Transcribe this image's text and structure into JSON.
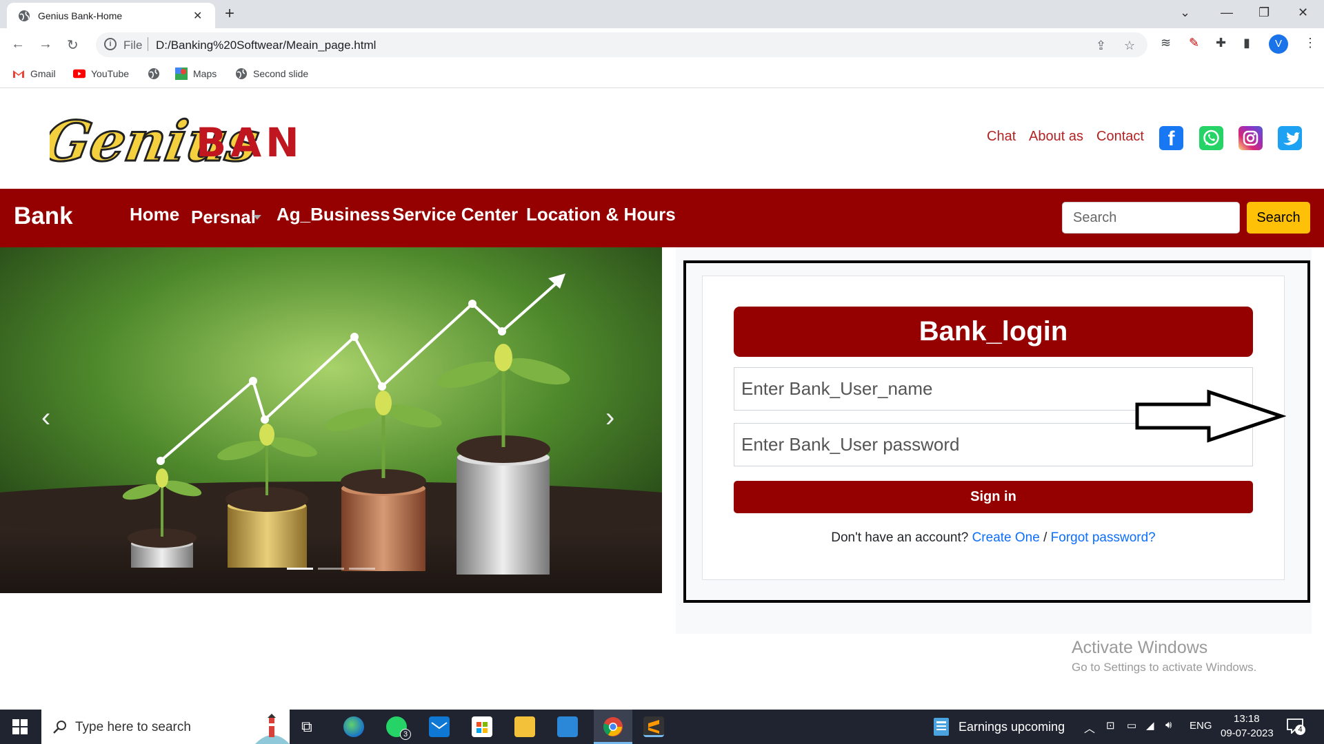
{
  "browser": {
    "tab_title": "Genius Bank-Home",
    "address_file_label": "File",
    "url": "D:/Banking%20Softwear/Meain_page.html",
    "avatar_letter": "V",
    "bookmarks": [
      {
        "label": "Gmail",
        "icon": "gmail-icon"
      },
      {
        "label": "YouTube",
        "icon": "youtube-icon"
      },
      {
        "label": "",
        "icon": "globe-icon"
      },
      {
        "label": "Maps",
        "icon": "maps-icon"
      },
      {
        "label": "Second slide",
        "icon": "globe-icon"
      }
    ]
  },
  "header": {
    "logo_script": "Genius",
    "logo_block": "BANK",
    "links": [
      "Chat",
      "About as",
      "Contact"
    ],
    "social": [
      "facebook",
      "whatsapp",
      "instagram",
      "twitter"
    ]
  },
  "navbar": {
    "brand": "Bank",
    "items": [
      "Home",
      "Persnal",
      "Ag_Business",
      "Service Center",
      "Location & Hours"
    ],
    "search_placeholder": "Search",
    "search_button": "Search"
  },
  "login": {
    "title": "Bank_login",
    "username_placeholder": "Enter Bank_User_name",
    "password_placeholder": "Enter Bank_User password",
    "signin_label": "Sign in",
    "account_prompt": "Don't have an account?",
    "create_link": "Create One",
    "divider": "/",
    "forgot_link": "Forgot password?"
  },
  "watermark": {
    "line1": "Activate Windows",
    "line2": "Go to Settings to activate Windows."
  },
  "taskbar": {
    "search_placeholder": "Type here to search",
    "whatsapp_badge": "3",
    "news_text": "Earnings upcoming",
    "language": "ENG",
    "time": "13:18",
    "date": "09-07-2023",
    "notification_count": "4"
  },
  "colors": {
    "brand_red": "#950000",
    "link_red": "#b22222",
    "search_yellow": "#ffc107",
    "link_blue": "#0d6efd"
  }
}
